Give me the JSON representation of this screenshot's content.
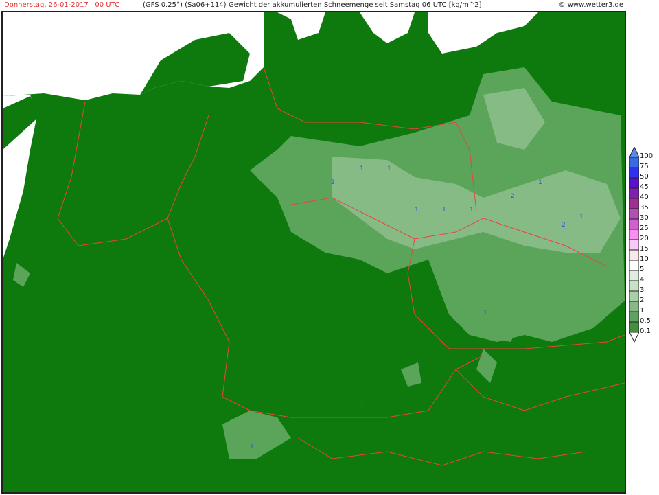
{
  "header": {
    "date": "Donnerstag, 26-01-2017",
    "time": "00 UTC",
    "model": "(GFS 0.25°) (Sa06+114)",
    "description": "Gewicht der akkumulierten Schneemenge seit Samstag 06 UTC [kg/m^2]",
    "copyright": "© www.wetter3.de"
  },
  "legend": {
    "labels": [
      "100",
      "75",
      "50",
      "45",
      "40",
      "35",
      "30",
      "25",
      "20",
      "15",
      "10",
      "5",
      "4",
      "3",
      "2",
      "1",
      "0.5",
      "0.1"
    ],
    "colors": [
      "#3a6ae0",
      "#3030f0",
      "#5a10d0",
      "#8020b0",
      "#a03090",
      "#b050b0",
      "#d060d0",
      "#f890f0",
      "#f8c8f8",
      "#f8e8e8",
      "#ffffff",
      "#e0ece0",
      "#c8e0c8",
      "#a8d0a8",
      "#88b888",
      "#60a060",
      "#409040"
    ],
    "top_arrow_color": "#5a8ae8",
    "bottom_arrow_color": "#ffffff"
  },
  "map": {
    "land_color": "#0e7a0e",
    "sea_color": "#ffffff",
    "border_color": "#f04040",
    "snow_light": "#5aa55a",
    "snow_lighter": "#86bb86",
    "value_labels": [
      "1",
      "2"
    ]
  }
}
